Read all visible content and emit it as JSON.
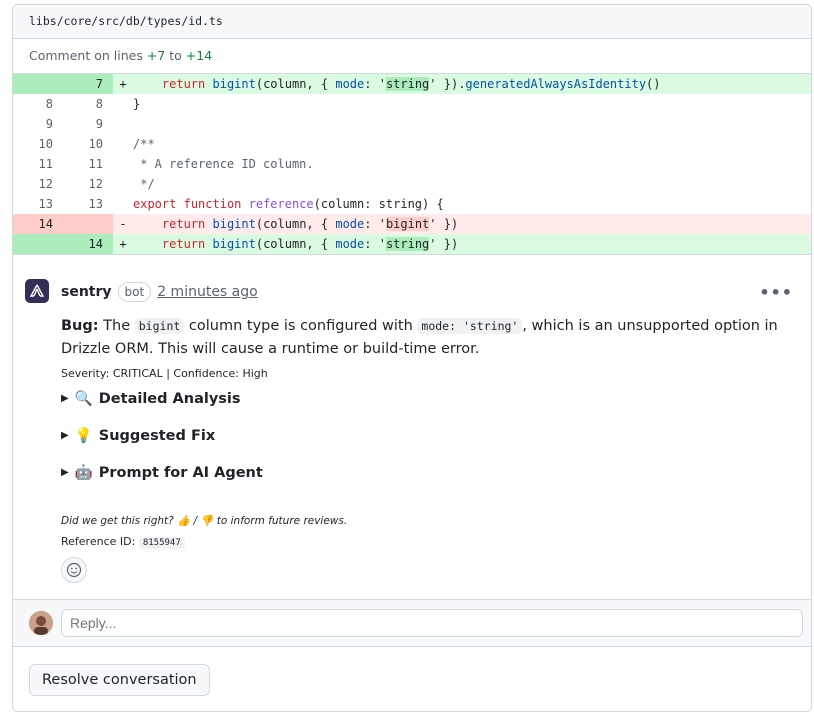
{
  "file": {
    "path": "libs/core/src/db/types/id.ts"
  },
  "comment_lines": {
    "prefix": "Comment on lines",
    "start": "+7",
    "joiner": "to",
    "end": "+14"
  },
  "diff": {
    "rows": [
      {
        "type": "add",
        "old": "",
        "new": "7",
        "sign": "+"
      },
      {
        "type": "ctx",
        "old": "8",
        "new": "8",
        "sign": ""
      },
      {
        "type": "ctx",
        "old": "9",
        "new": "9",
        "sign": ""
      },
      {
        "type": "ctx",
        "old": "10",
        "new": "10",
        "sign": ""
      },
      {
        "type": "ctx",
        "old": "11",
        "new": "11",
        "sign": ""
      },
      {
        "type": "ctx",
        "old": "12",
        "new": "12",
        "sign": ""
      },
      {
        "type": "ctx",
        "old": "13",
        "new": "13",
        "sign": ""
      },
      {
        "type": "del",
        "old": "14",
        "new": "",
        "sign": "-"
      },
      {
        "type": "add",
        "old": "",
        "new": "14",
        "sign": "+"
      }
    ],
    "code": {
      "r0": {
        "indent": "    ",
        "kw": "return",
        "fn": "bigint",
        "a": "(column, { ",
        "prop": "mode",
        "b": ": '",
        "hl": "string",
        "c": "' }).",
        "fn2": "generatedAlwaysAsIdentity",
        "d": "()"
      },
      "r1": "}",
      "r3": "/**",
      "r4": " * A reference ID column.",
      "r5": " */",
      "r6": {
        "kw": "export",
        "kw2": "function",
        "fn": "reference",
        "rest": "(column: string) {"
      },
      "r7": {
        "indent": "    ",
        "kw": "return",
        "fn": "bigint",
        "a": "(column, { ",
        "prop": "mode",
        "b": ": '",
        "hl": "bigint",
        "c": "' })"
      },
      "r8": {
        "indent": "    ",
        "kw": "return",
        "fn": "bigint",
        "a": "(column, { ",
        "prop": "mode",
        "b": ": '",
        "hl": "string",
        "c": "' })"
      }
    }
  },
  "comment": {
    "author": "sentry",
    "badge": "bot",
    "time": "2 minutes ago",
    "bug_label": "Bug:",
    "t1": " The ",
    "code1": "bigint",
    "t2": " column type is configured with ",
    "code2": "mode: 'string'",
    "t3": ", which is an unsupported option in Drizzle ORM. This will cause a runtime or build-time error.",
    "severity": "Severity: CRITICAL | Confidence: High",
    "sections": [
      {
        "emoji": "🔍",
        "label": "Detailed Analysis"
      },
      {
        "emoji": "💡",
        "label": "Suggested Fix"
      },
      {
        "emoji": "🤖",
        "label": "Prompt for AI Agent"
      }
    ],
    "feedback": "Did we get this right? 👍 / 👎 to inform future reviews.",
    "ref_label": "Reference ID:",
    "ref_id": "8155947"
  },
  "reply": {
    "placeholder": "Reply..."
  },
  "resolve": {
    "label": "Resolve conversation"
  },
  "colors": {
    "add_bg": "#dafbe1",
    "del_bg": "#ffebe9",
    "sentry": "#362d59"
  }
}
